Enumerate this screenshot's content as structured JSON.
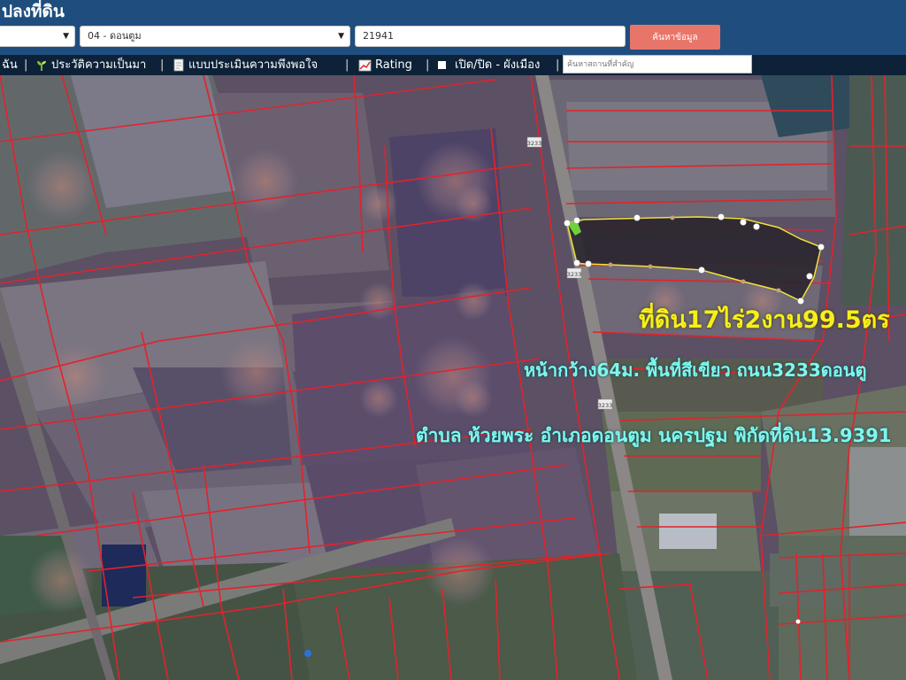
{
  "header": {
    "title": "ปลงที่ดิน",
    "province_select": "",
    "district_select": "04 - ดอนตูม",
    "parcel_input": "21941",
    "search_button": "ค้นหาข้อมูล"
  },
  "toolbar": {
    "item_0": "ฉัน",
    "item_1": "ประวัติความเป็นมา",
    "item_2": "แบบประเมินความพึงพอใจ",
    "item_3": "Rating",
    "item_4": "เปิด/ปิด - ผังเมือง",
    "place_placeholder": "ค้นหาสถานที่สำคัญ"
  },
  "map": {
    "road_labels": [
      "3233",
      "3233",
      "3233"
    ],
    "overlay_line1": "ที่ดิน17ไร่2งาน99.5ตร",
    "overlay_line2": "หน้ากว้าง64ม. พื้นที่สีเขียว ถนน3233ดอนตู",
    "overlay_line3": "ตำบล ห้วยพระ อำเภอดอนตูม นครปฐม พิกัดที่ดิน13.9391",
    "highlight_color": "#f3e13a",
    "parcel_line_color": "#e3222c"
  },
  "colors": {
    "header_bg": "#1f4e7e",
    "toolbar_bg": "#0d2238",
    "search_button_bg": "#e8756a"
  }
}
